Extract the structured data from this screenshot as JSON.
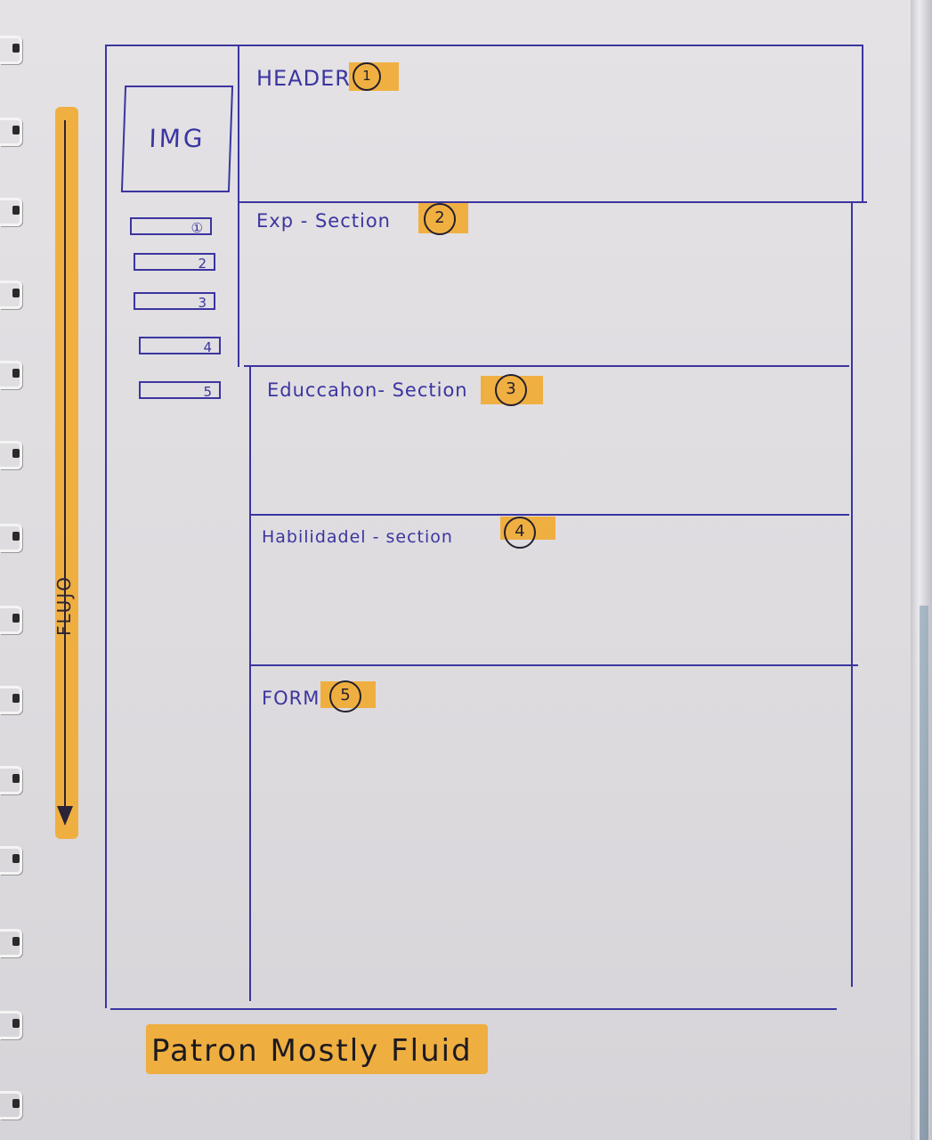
{
  "sidebar": {
    "image_label": "IMG",
    "nav_items": [
      "①",
      "2",
      "3",
      "4",
      "5"
    ]
  },
  "sections": [
    {
      "label": "HEADER",
      "number": "1"
    },
    {
      "label": "Exp - Section",
      "number": "2"
    },
    {
      "label": "Educcahon- Section",
      "number": "3"
    },
    {
      "label": "Habilidadel - section",
      "number": "4"
    },
    {
      "label": "FORM",
      "number": "5"
    }
  ],
  "flow_label": "FLUJO",
  "caption": "Patron Mostly Fluid",
  "colors": {
    "pen": "#3b35a0",
    "highlighter": "#f1a92a",
    "paper": "#e2e0e3"
  }
}
